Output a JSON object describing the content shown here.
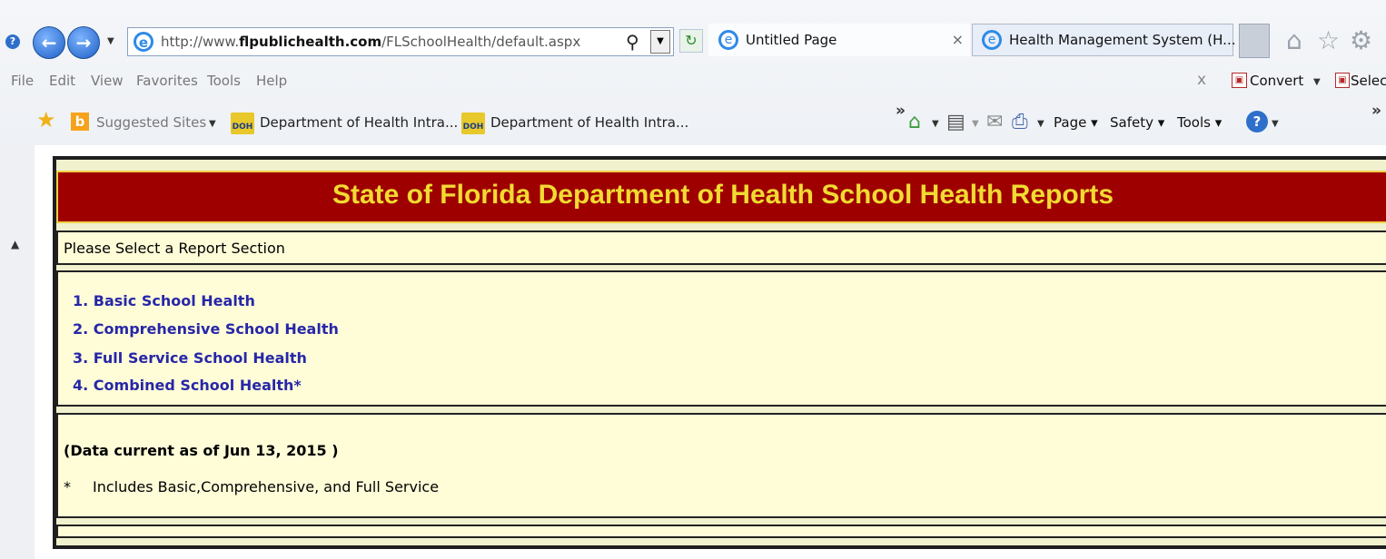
{
  "browser": {
    "url_prefix": "http://www.",
    "url_domain": "flpublichealth.com",
    "url_path": "/FLSchoolHealth/default.aspx",
    "tabs": [
      {
        "label": "Untitled Page",
        "close": "×"
      },
      {
        "label": "Health Management System (H..."
      }
    ],
    "menu": [
      "File",
      "Edit",
      "View",
      "Favorites",
      "Tools",
      "Help"
    ],
    "menu_close": "x",
    "convert_label": "Convert",
    "select_label": "Selec",
    "favorites": {
      "suggested": "Suggested Sites",
      "items": [
        "Department of Health Intra...",
        "Department of Health Intra..."
      ]
    },
    "commands": {
      "page": "Page",
      "safety": "Safety",
      "tools": "Tools"
    }
  },
  "page": {
    "title": "State of Florida Department of Health School Health Reports",
    "select_prompt": "Please Select a Report Section",
    "links": [
      "1. Basic School Health",
      "2. Comprehensive School Health",
      "3. Full Service School Health",
      "4. Combined School Health*"
    ],
    "data_current": "(Data current as of Jun 13, 2015 )",
    "note_marker": "*",
    "note_text": "Includes Basic,Comprehensive, and Full Service"
  },
  "colors": {
    "header_bg": "#9e0000",
    "header_text": "#f1da32",
    "panel_bg": "#fffdd8",
    "link": "#2727a8"
  }
}
